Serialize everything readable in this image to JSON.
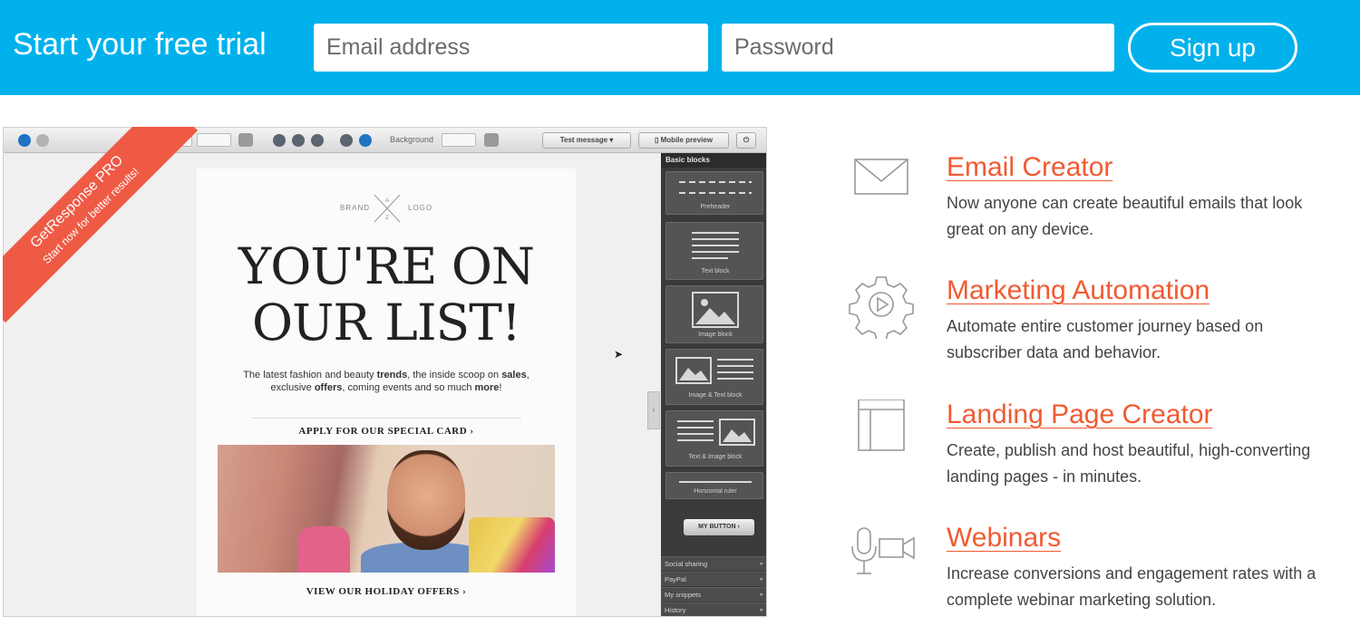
{
  "signup": {
    "title": "Start your free trial",
    "email_placeholder": "Email address",
    "password_placeholder": "Password",
    "button_label": "Sign up",
    "bar_color": "#00b1ec"
  },
  "editor": {
    "ribbon": {
      "line1": "GetResponse PRO",
      "line2": "Start now for better results!",
      "color": "#ef5a45"
    },
    "toolbar": {
      "background_label": "Background",
      "test_message_label": "Test message",
      "mobile_preview_label": "Mobile preview"
    },
    "email": {
      "brand_left": "BRAND",
      "brand_right": "LOGO",
      "brand_letters": [
        "A",
        "Z"
      ],
      "hero_line1": "YOU'RE ON",
      "hero_line2": "OUR LIST!",
      "sub_parts": [
        "The latest fashion and beauty ",
        "trends",
        ", the inside scoop on ",
        "sales",
        ",",
        "exclusive ",
        "offers",
        ", coming events and so much ",
        "more",
        "!"
      ],
      "cta1": "APPLY FOR OUR SPECIAL CARD ›",
      "cta2": "VIEW OUR HOLIDAY OFFERS ›"
    },
    "panel": {
      "heading": "Basic blocks",
      "blocks": [
        "Preheader",
        "Text block",
        "Image block",
        "Image & Text block",
        "Text & Image block",
        "Horizontal ruler"
      ],
      "my_button": "MY BUTTON ›",
      "accordion": [
        "Social sharing",
        "PayPal",
        "My snippets",
        "History"
      ]
    }
  },
  "features": [
    {
      "icon": "envelope-icon",
      "title": "Email Creator",
      "desc": "Now anyone can create beautiful emails that look great on any device."
    },
    {
      "icon": "gear-play-icon",
      "title": "Marketing Automation",
      "desc": "Automate entire customer journey based on subscriber data and behavior."
    },
    {
      "icon": "layout-icon",
      "title": "Landing Page Creator",
      "desc": "Create, publish and host beautiful, high-converting landing pages - in minutes."
    },
    {
      "icon": "webinar-icon",
      "title": "Webinars",
      "desc": "Increase conversions and engagement rates with a complete webinar marketing solution."
    }
  ],
  "accent_color": "#f15a32"
}
